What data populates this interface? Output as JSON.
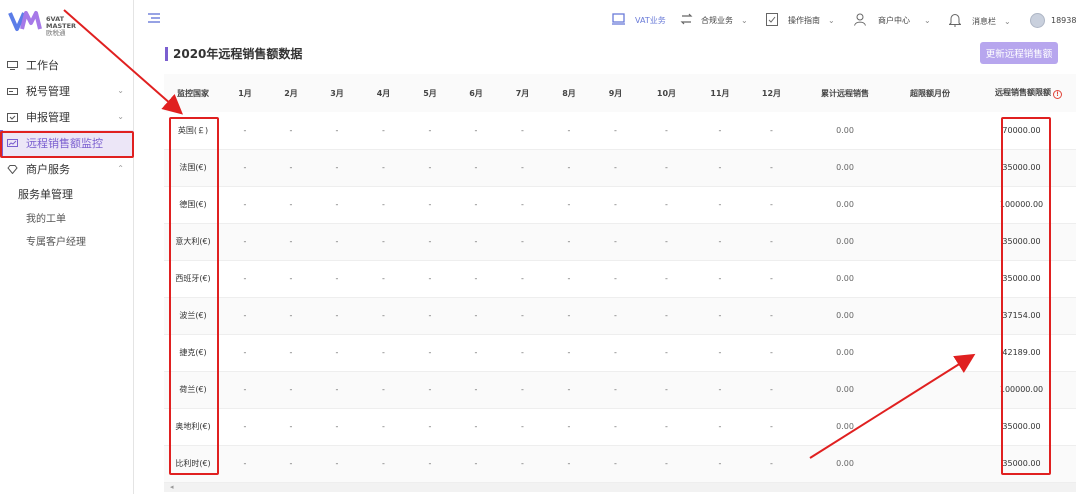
{
  "brand": {
    "line1": "6VAT",
    "line2": "MASTER",
    "line3": "欧税通"
  },
  "sidebar": {
    "items": [
      {
        "label": "工作台",
        "icon": "monitor-icon"
      },
      {
        "label": "税号管理",
        "icon": "card-icon"
      },
      {
        "label": "申报管理",
        "icon": "report-icon"
      },
      {
        "label": "远程销售额监控",
        "icon": "chart-monitor-icon"
      },
      {
        "label": "商户服务",
        "icon": "diamond-icon"
      }
    ],
    "subhead": "服务单管理",
    "subitems": [
      {
        "label": "我的工单"
      },
      {
        "label": "专属客户经理"
      }
    ]
  },
  "topbar": {
    "vat": "VAT业务",
    "compliance": "合规业务",
    "guide": "操作指南",
    "merchant": "商户中心",
    "messages": "消息栏",
    "user": "18938"
  },
  "page": {
    "title": "2020年远程销售额数据",
    "refresh_label": "更新远程销售额"
  },
  "table": {
    "headers": {
      "country": "监控国家",
      "months": [
        "1月",
        "2月",
        "3月",
        "4月",
        "5月",
        "6月",
        "7月",
        "8月",
        "9月",
        "10月",
        "11月",
        "12月"
      ],
      "total": "累计远程销售",
      "exceed": "超限额月份",
      "limit": "远程销售额限额"
    },
    "rows": [
      {
        "country": "英国(￡)",
        "months": [
          "-",
          "-",
          "-",
          "-",
          "-",
          "-",
          "-",
          "-",
          "-",
          "-",
          "-",
          "-"
        ],
        "total": "0.00",
        "exceed": "",
        "limit": "70000.00"
      },
      {
        "country": "法国(€)",
        "months": [
          "-",
          "-",
          "-",
          "-",
          "-",
          "-",
          "-",
          "-",
          "-",
          "-",
          "-",
          "-"
        ],
        "total": "0.00",
        "exceed": "",
        "limit": "35000.00"
      },
      {
        "country": "德国(€)",
        "months": [
          "-",
          "-",
          "-",
          "-",
          "-",
          "-",
          "-",
          "-",
          "-",
          "-",
          "-",
          "-"
        ],
        "total": "0.00",
        "exceed": "",
        "limit": "100000.00"
      },
      {
        "country": "意大利(€)",
        "months": [
          "-",
          "-",
          "-",
          "-",
          "-",
          "-",
          "-",
          "-",
          "-",
          "-",
          "-",
          "-"
        ],
        "total": "0.00",
        "exceed": "",
        "limit": "35000.00"
      },
      {
        "country": "西班牙(€)",
        "months": [
          "-",
          "-",
          "-",
          "-",
          "-",
          "-",
          "-",
          "-",
          "-",
          "-",
          "-",
          "-"
        ],
        "total": "0.00",
        "exceed": "",
        "limit": "35000.00"
      },
      {
        "country": "波兰(€)",
        "months": [
          "-",
          "-",
          "-",
          "-",
          "-",
          "-",
          "-",
          "-",
          "-",
          "-",
          "-",
          "-"
        ],
        "total": "0.00",
        "exceed": "",
        "limit": "37154.00"
      },
      {
        "country": "捷克(€)",
        "months": [
          "-",
          "-",
          "-",
          "-",
          "-",
          "-",
          "-",
          "-",
          "-",
          "-",
          "-",
          "-"
        ],
        "total": "0.00",
        "exceed": "",
        "limit": "42189.00"
      },
      {
        "country": "荷兰(€)",
        "months": [
          "-",
          "-",
          "-",
          "-",
          "-",
          "-",
          "-",
          "-",
          "-",
          "-",
          "-",
          "-"
        ],
        "total": "0.00",
        "exceed": "",
        "limit": "100000.00"
      },
      {
        "country": "奥地利(€)",
        "months": [
          "-",
          "-",
          "-",
          "-",
          "-",
          "-",
          "-",
          "-",
          "-",
          "-",
          "-",
          "-"
        ],
        "total": "0.00",
        "exceed": "",
        "limit": "35000.00"
      },
      {
        "country": "比利时(€)",
        "months": [
          "-",
          "-",
          "-",
          "-",
          "-",
          "-",
          "-",
          "-",
          "-",
          "-",
          "-",
          "-"
        ],
        "total": "0.00",
        "exceed": "",
        "limit": "35000.00"
      }
    ]
  },
  "colors": {
    "accent": "#7b5fd0",
    "highlight": "#e02020",
    "button": "#b7a6ee"
  }
}
